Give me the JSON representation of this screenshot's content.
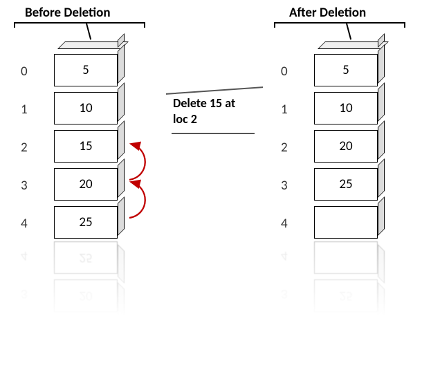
{
  "titles": {
    "before": "Before Deletion",
    "after": "After Deletion"
  },
  "caption": {
    "line1": "Delete 15 at",
    "line2": "loc 2"
  },
  "before": {
    "indices": [
      "0",
      "1",
      "2",
      "3",
      "4"
    ],
    "values": [
      "5",
      "10",
      "15",
      "20",
      "25"
    ]
  },
  "after": {
    "indices": [
      "0",
      "1",
      "2",
      "3",
      "4"
    ],
    "values": [
      "5",
      "10",
      "20",
      "25",
      ""
    ]
  },
  "reflection": {
    "indices": [
      "4",
      "3"
    ],
    "before_values": [
      "25",
      "20"
    ],
    "after_values": [
      "",
      "25"
    ]
  },
  "chart_data": {
    "type": "table",
    "title": "Array deletion at index 2",
    "operation": "delete value 15 at index 2",
    "before": [
      {
        "index": 0,
        "value": 5
      },
      {
        "index": 1,
        "value": 10
      },
      {
        "index": 2,
        "value": 15
      },
      {
        "index": 3,
        "value": 20
      },
      {
        "index": 4,
        "value": 25
      }
    ],
    "after": [
      {
        "index": 0,
        "value": 5
      },
      {
        "index": 1,
        "value": 10
      },
      {
        "index": 2,
        "value": 20
      },
      {
        "index": 3,
        "value": 25
      },
      {
        "index": 4,
        "value": null
      }
    ],
    "shifts": [
      {
        "from_index": 3,
        "to_index": 2,
        "value": 20
      },
      {
        "from_index": 4,
        "to_index": 3,
        "value": 25
      }
    ]
  }
}
